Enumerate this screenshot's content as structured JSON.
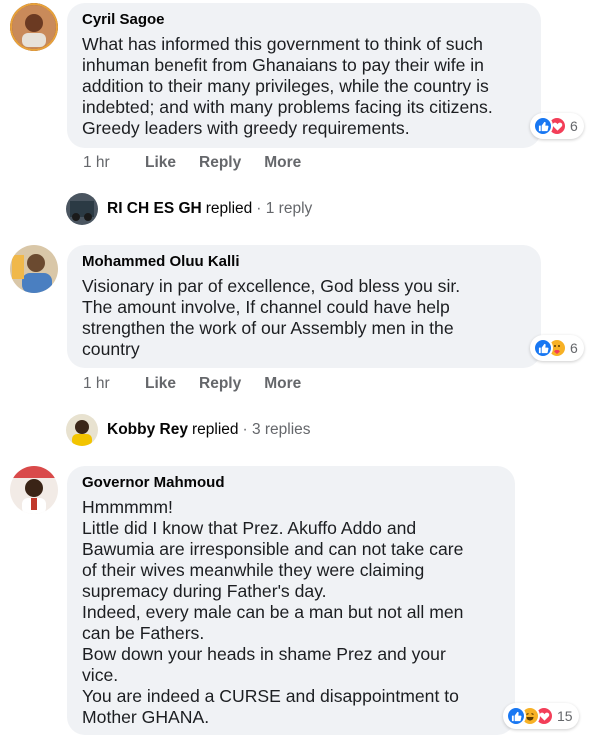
{
  "comments": [
    {
      "author": "Cyril Sagoe",
      "text": "What has informed this government to think of such\ninhuman benefit from Ghanaians to pay their wife in\naddition to their many privileges, while the country is\nindebted; and with many problems facing its citizens.\nGreedy leaders with greedy requirements.",
      "reaction_count": "6",
      "reactions": [
        "like-icon",
        "love-icon"
      ],
      "time": "1 hr",
      "like_label": "Like",
      "reply_label": "Reply",
      "more_label": "More",
      "reply_summary": {
        "name": "RI CH ES GH",
        "verb": "replied",
        "count": "· 1 reply"
      }
    },
    {
      "author": "Mohammed Oluu Kalli",
      "text": "Visionary in par of excellence, God bless you sir.\nThe amount involve, If channel could have help\nstrengthen the work of our Assembly men in the\ncountry",
      "reaction_count": "6",
      "reactions": [
        "like-icon",
        "care-icon"
      ],
      "time": "1 hr",
      "like_label": "Like",
      "reply_label": "Reply",
      "more_label": "More",
      "reply_summary": {
        "name": "Kobby Rey",
        "verb": "replied",
        "count": "· 3 replies"
      }
    },
    {
      "author": "Governor Mahmoud",
      "text": "Hmmmmm!\nLittle did I know that Prez. Akuffo Addo and\nBawumia are irresponsible and can not take care\nof their wives meanwhile they were claiming\nsupremacy during Father's day.\nIndeed, every male can be a man but not all men\ncan be Fathers.\nBow down your heads in shame Prez and your\nvice.\nYou are indeed a CURSE and disappointment to\nMother GHANA.",
      "reaction_count": "15",
      "reactions": [
        "like-icon",
        "haha-icon",
        "love-icon"
      ]
    }
  ],
  "colors": {
    "bubble": "#f0f2f5",
    "like": "#1877f2",
    "love": "#f33e58",
    "emoji": "#f7b125",
    "meta": "#65676b"
  }
}
